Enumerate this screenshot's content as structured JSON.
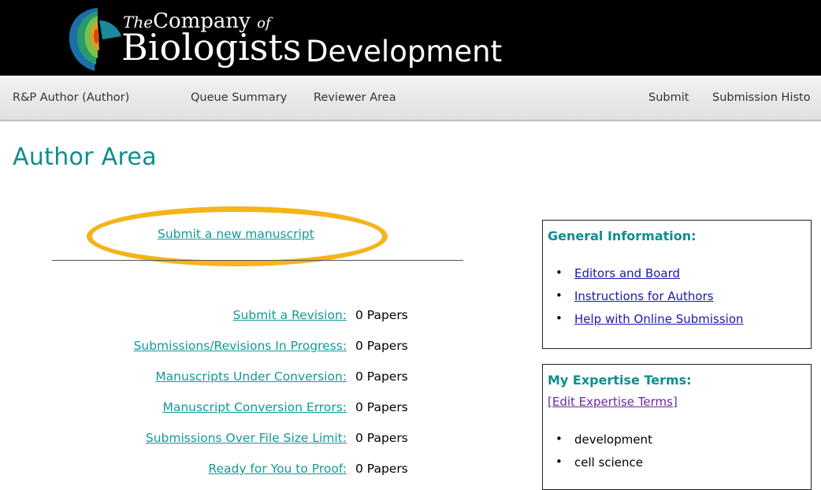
{
  "header": {
    "brand_the": "The",
    "brand_company": "Company",
    "brand_of": "of",
    "brand_biologists": "Biologists",
    "journal": "Development"
  },
  "nav": {
    "user": "R&P Author (Author)",
    "queue_summary": "Queue Summary",
    "reviewer_area": "Reviewer Area",
    "submit": "Submit",
    "submission_history": "Submission Histo"
  },
  "page_title": "Author Area",
  "submit_new": "Submit a new manuscript",
  "queues": [
    {
      "label": "Submit a Revision:",
      "count": "0 Papers"
    },
    {
      "label": "Submissions/Revisions In Progress:",
      "count": "0 Papers"
    },
    {
      "label": "Manuscripts Under Conversion:",
      "count": "0 Papers"
    },
    {
      "label": "Manuscript Conversion Errors:",
      "count": "0 Papers"
    },
    {
      "label": "Submissions Over File Size Limit:",
      "count": "0 Papers"
    },
    {
      "label": "Ready for You to Proof:",
      "count": "0 Papers"
    }
  ],
  "general_info": {
    "title": "General Information:",
    "links": [
      "Editors and Board",
      "Instructions for Authors",
      "Help with Online Submission"
    ]
  },
  "expertise": {
    "title": "My Expertise Terms:",
    "edit_link": "[Edit Expertise Terms]",
    "terms": [
      "development",
      "cell science"
    ]
  },
  "colors": {
    "accent": "#0b8e8f",
    "highlight": "#f4b41a",
    "link_blue": "#1a1aa8",
    "link_visited": "#6b2a9b"
  }
}
